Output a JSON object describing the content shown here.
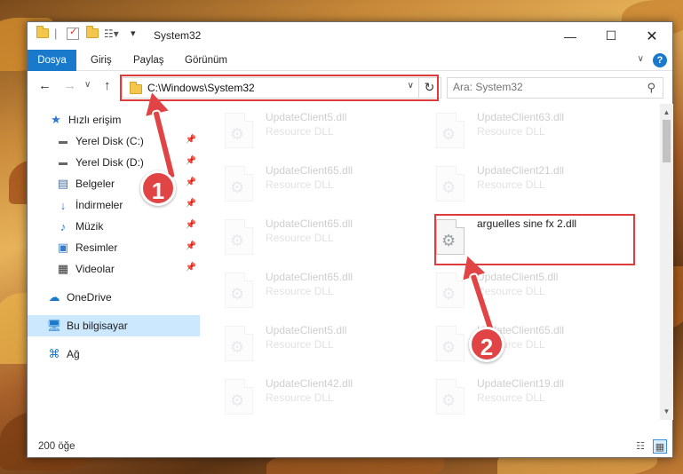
{
  "window": {
    "title": "System32"
  },
  "ribbon": {
    "tabs": [
      "Dosya",
      "Giriş",
      "Paylaş",
      "Görünüm"
    ],
    "help": "?"
  },
  "address": {
    "path": "C:\\Windows\\System32"
  },
  "search": {
    "placeholder": "Ara: System32"
  },
  "sidebar": {
    "items": [
      {
        "label": "Hızlı erişim",
        "icon": "star-icon"
      },
      {
        "label": "Yerel Disk (C:)",
        "icon": "drive-icon",
        "pinned": true
      },
      {
        "label": "Yerel Disk (D:)",
        "icon": "drive-icon",
        "pinned": true
      },
      {
        "label": "Belgeler",
        "icon": "documents-icon",
        "pinned": true
      },
      {
        "label": "İndirmeler",
        "icon": "download-icon",
        "pinned": true
      },
      {
        "label": "Müzik",
        "icon": "music-icon",
        "pinned": true
      },
      {
        "label": "Resimler",
        "icon": "pictures-icon",
        "pinned": true
      },
      {
        "label": "Videolar",
        "icon": "videos-icon",
        "pinned": true
      },
      {
        "label": "OneDrive",
        "icon": "cloud-icon"
      },
      {
        "label": "Bu bilgisayar",
        "icon": "computer-icon",
        "selected": true
      },
      {
        "label": "Ağ",
        "icon": "network-icon"
      }
    ]
  },
  "files": [
    {
      "name": "UpdateClient5.dll",
      "type": "Resource DLL"
    },
    {
      "name": "UpdateClient63.dll",
      "type": "Resource DLL"
    },
    {
      "name": "UpdateClient65.dll",
      "type": "Resource DLL"
    },
    {
      "name": "UpdateClient21.dll",
      "type": "Resource DLL"
    },
    {
      "name": "UpdateClient65.dll",
      "type": "Resource DLL"
    },
    {
      "name": "arguelles sine fx 2.dll",
      "type": ""
    },
    {
      "name": "UpdateClient65.dll",
      "type": "Resource DLL"
    },
    {
      "name": "UpdateClient5.dll",
      "type": "Resource DLL"
    },
    {
      "name": "UpdateClient5.dll",
      "type": "Resource DLL"
    },
    {
      "name": "UpdateClient65.dll",
      "type": "Resource DLL"
    },
    {
      "name": "UpdateClient42.dll",
      "type": "Resource DLL"
    },
    {
      "name": "UpdateClient19.dll",
      "type": "Resource DLL"
    }
  ],
  "status": {
    "count": "200 öğe"
  },
  "callouts": [
    "1",
    "2"
  ],
  "colors": {
    "accent": "#1979ca",
    "highlight": "#e03b3b",
    "selected": "#cce8ff"
  }
}
